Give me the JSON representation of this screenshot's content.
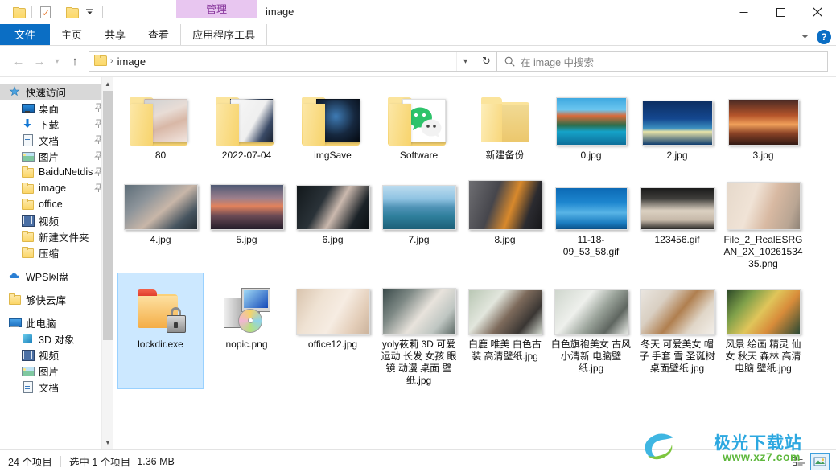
{
  "titlebar": {
    "quick_access": [
      {
        "name": "folder-icon",
        "label": ""
      },
      {
        "name": "properties-icon",
        "label": ""
      },
      {
        "name": "new-folder-icon",
        "label": ""
      },
      {
        "name": "customize-caret-icon",
        "label": ""
      }
    ],
    "contextual_tab_title": "管理",
    "window_title": "image",
    "minimize": "─",
    "maximize": "□",
    "close": "✕"
  },
  "ribbon": {
    "tabs": [
      {
        "label": "文件",
        "type": "file"
      },
      {
        "label": "主页",
        "type": "normal"
      },
      {
        "label": "共享",
        "type": "normal"
      },
      {
        "label": "查看",
        "type": "normal"
      },
      {
        "label": "应用程序工具",
        "type": "contextual"
      }
    ],
    "collapse_icon": "chevron-down-icon",
    "help_label": "?"
  },
  "addressbar": {
    "back": "←",
    "forward": "→",
    "recent": "⌄",
    "up": "↑",
    "breadcrumb_root_icon": "folder-icon",
    "breadcrumb_separator": "›",
    "breadcrumb_text": "image",
    "dropdown_icon": "chevron-down-icon",
    "refresh_icon": "↻",
    "search_icon": "search-icon",
    "search_placeholder": "在 image 中搜索",
    "search_value": ""
  },
  "nav": {
    "groups": [
      {
        "header": {
          "label": "快速访问",
          "icon": "pin-star-icon",
          "selected": true
        },
        "items": [
          {
            "label": "桌面",
            "icon": "desktop-icon",
            "pinned": true
          },
          {
            "label": "下载",
            "icon": "download-icon",
            "pinned": true
          },
          {
            "label": "文档",
            "icon": "document-icon",
            "pinned": true
          },
          {
            "label": "图片",
            "icon": "pictures-icon",
            "pinned": true
          },
          {
            "label": "BaiduNetdis",
            "icon": "folder-icon",
            "pinned": true
          },
          {
            "label": "image",
            "icon": "folder-icon",
            "pinned": true
          },
          {
            "label": "office",
            "icon": "folder-icon",
            "pinned": false
          },
          {
            "label": "视频",
            "icon": "video-icon",
            "pinned": false
          },
          {
            "label": "新建文件夹",
            "icon": "folder-icon",
            "pinned": false
          },
          {
            "label": "压缩",
            "icon": "folder-icon",
            "pinned": false
          }
        ]
      },
      {
        "header": {
          "label": "WPS网盘",
          "icon": "cloud-icon",
          "selected": false
        },
        "items": []
      },
      {
        "header": {
          "label": "够快云库",
          "icon": "folder-icon",
          "selected": false
        },
        "items": []
      },
      {
        "header": {
          "label": "此电脑",
          "icon": "this-pc-icon",
          "selected": false
        },
        "items": [
          {
            "label": "3D 对象",
            "icon": "3d-objects-icon",
            "pinned": false
          },
          {
            "label": "视频",
            "icon": "video-icon",
            "pinned": false
          },
          {
            "label": "图片",
            "icon": "pictures-icon",
            "pinned": false
          },
          {
            "label": "文档",
            "icon": "document-icon",
            "pinned": false
          }
        ]
      }
    ],
    "scrollbar": {
      "up_icon": "chevron-up-icon",
      "down_icon": "chevron-down-icon"
    }
  },
  "files": [
    {
      "name": "80",
      "kind": "folder-preview",
      "art": "a-80",
      "selected": false
    },
    {
      "name": "2022-07-04",
      "kind": "folder-preview",
      "art": "a-2022",
      "selected": false
    },
    {
      "name": "imgSave",
      "kind": "folder-preview",
      "art": "a-img",
      "selected": false
    },
    {
      "name": "Software",
      "kind": "folder-wechat",
      "art": "a-soft",
      "selected": false
    },
    {
      "name": "新建备份",
      "kind": "folder-plain",
      "art": "",
      "selected": false
    },
    {
      "name": "0.jpg",
      "kind": "image",
      "art": "a-0",
      "selected": false
    },
    {
      "name": "2.jpg",
      "kind": "image",
      "art": "a-2",
      "selected": false
    },
    {
      "name": "3.jpg",
      "kind": "image",
      "art": "a-3",
      "selected": false
    },
    {
      "name": "4.jpg",
      "kind": "image",
      "art": "a-4",
      "selected": false
    },
    {
      "name": "5.jpg",
      "kind": "image",
      "art": "a-5",
      "selected": false
    },
    {
      "name": "6.jpg",
      "kind": "image",
      "art": "a-6",
      "selected": false
    },
    {
      "name": "7.jpg",
      "kind": "image",
      "art": "a-7",
      "selected": false
    },
    {
      "name": "8.jpg",
      "kind": "image",
      "art": "a-8",
      "selected": false
    },
    {
      "name": "11-18-09_53_58.gif",
      "kind": "image",
      "art": "a-1118",
      "selected": false
    },
    {
      "name": "123456.gif",
      "kind": "image",
      "art": "a-123",
      "selected": false
    },
    {
      "name": "File_2_RealESRGAN_2X_1026153435.png",
      "kind": "image",
      "art": "a-file2",
      "selected": false
    },
    {
      "name": "lockdir.exe",
      "kind": "lockdir",
      "art": "",
      "selected": true
    },
    {
      "name": "nopic.png",
      "kind": "nopic",
      "art": "",
      "selected": false
    },
    {
      "name": "office12.jpg",
      "kind": "image",
      "art": "a-off12",
      "selected": false
    },
    {
      "name": "yoly莜莉 3D 可爱 运动 长发 女孩 眼镜 动漫 桌面 壁纸.jpg",
      "kind": "image",
      "art": "a-yoly",
      "selected": false
    },
    {
      "name": "白鹿 唯美 白色古装 高清壁纸.jpg",
      "kind": "image",
      "art": "a-bail",
      "selected": false
    },
    {
      "name": "白色旗袍美女 古风 小清新 电脑壁纸.jpg",
      "kind": "image",
      "art": "a-baise",
      "selected": false
    },
    {
      "name": "冬天 可爱美女 帽子 手套 雪 圣诞树 桌面壁纸.jpg",
      "kind": "image",
      "art": "a-dong",
      "selected": false
    },
    {
      "name": "风景 绘画 精灵 仙女 秋天 森林 高清 电脑 壁纸.jpg",
      "kind": "image",
      "art": "a-feng",
      "selected": false
    }
  ],
  "status": {
    "item_count": "24 个项目",
    "selection": "选中 1 个项目",
    "size": "1.36 MB",
    "view_details_icon": "details-view-icon",
    "view_thumbnails_icon": "large-icons-view-icon"
  },
  "watermark": {
    "title": "极光下载站",
    "url": "www.xz7.com"
  },
  "colors": {
    "accent": "#0b6ec4",
    "selection": "#cce8ff",
    "contextual_tab": "#e8c6f0",
    "contextual_tab_text": "#8a3a9e",
    "folder_yellow": "#fbe49c"
  }
}
